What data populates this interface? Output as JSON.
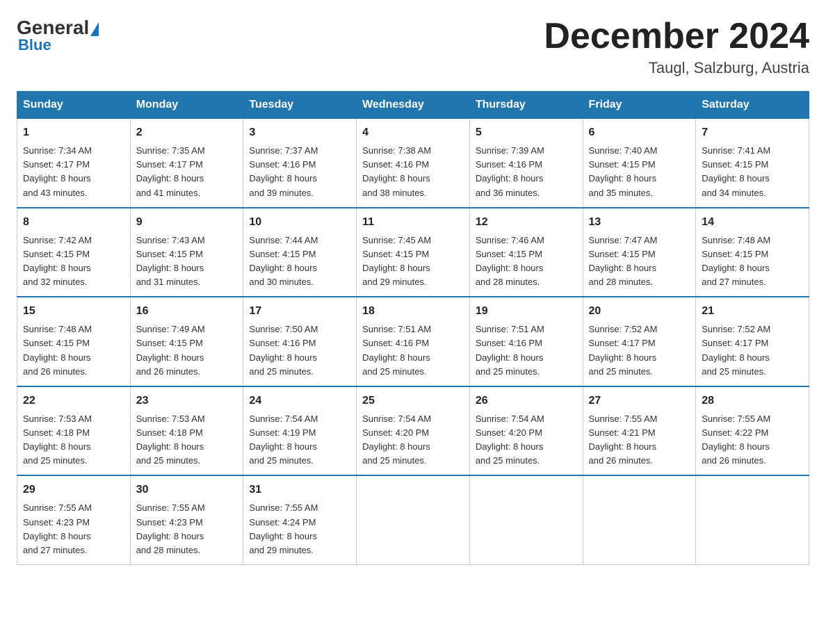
{
  "logo": {
    "general": "General",
    "blue": "Blue",
    "subtitle": "Blue"
  },
  "header": {
    "title": "December 2024",
    "location": "Taugl, Salzburg, Austria"
  },
  "weekdays": [
    "Sunday",
    "Monday",
    "Tuesday",
    "Wednesday",
    "Thursday",
    "Friday",
    "Saturday"
  ],
  "weeks": [
    [
      {
        "day": "1",
        "sunrise": "7:34 AM",
        "sunset": "4:17 PM",
        "daylight": "8 hours and 43 minutes."
      },
      {
        "day": "2",
        "sunrise": "7:35 AM",
        "sunset": "4:17 PM",
        "daylight": "8 hours and 41 minutes."
      },
      {
        "day": "3",
        "sunrise": "7:37 AM",
        "sunset": "4:16 PM",
        "daylight": "8 hours and 39 minutes."
      },
      {
        "day": "4",
        "sunrise": "7:38 AM",
        "sunset": "4:16 PM",
        "daylight": "8 hours and 38 minutes."
      },
      {
        "day": "5",
        "sunrise": "7:39 AM",
        "sunset": "4:16 PM",
        "daylight": "8 hours and 36 minutes."
      },
      {
        "day": "6",
        "sunrise": "7:40 AM",
        "sunset": "4:15 PM",
        "daylight": "8 hours and 35 minutes."
      },
      {
        "day": "7",
        "sunrise": "7:41 AM",
        "sunset": "4:15 PM",
        "daylight": "8 hours and 34 minutes."
      }
    ],
    [
      {
        "day": "8",
        "sunrise": "7:42 AM",
        "sunset": "4:15 PM",
        "daylight": "8 hours and 32 minutes."
      },
      {
        "day": "9",
        "sunrise": "7:43 AM",
        "sunset": "4:15 PM",
        "daylight": "8 hours and 31 minutes."
      },
      {
        "day": "10",
        "sunrise": "7:44 AM",
        "sunset": "4:15 PM",
        "daylight": "8 hours and 30 minutes."
      },
      {
        "day": "11",
        "sunrise": "7:45 AM",
        "sunset": "4:15 PM",
        "daylight": "8 hours and 29 minutes."
      },
      {
        "day": "12",
        "sunrise": "7:46 AM",
        "sunset": "4:15 PM",
        "daylight": "8 hours and 28 minutes."
      },
      {
        "day": "13",
        "sunrise": "7:47 AM",
        "sunset": "4:15 PM",
        "daylight": "8 hours and 28 minutes."
      },
      {
        "day": "14",
        "sunrise": "7:48 AM",
        "sunset": "4:15 PM",
        "daylight": "8 hours and 27 minutes."
      }
    ],
    [
      {
        "day": "15",
        "sunrise": "7:48 AM",
        "sunset": "4:15 PM",
        "daylight": "8 hours and 26 minutes."
      },
      {
        "day": "16",
        "sunrise": "7:49 AM",
        "sunset": "4:15 PM",
        "daylight": "8 hours and 26 minutes."
      },
      {
        "day": "17",
        "sunrise": "7:50 AM",
        "sunset": "4:16 PM",
        "daylight": "8 hours and 25 minutes."
      },
      {
        "day": "18",
        "sunrise": "7:51 AM",
        "sunset": "4:16 PM",
        "daylight": "8 hours and 25 minutes."
      },
      {
        "day": "19",
        "sunrise": "7:51 AM",
        "sunset": "4:16 PM",
        "daylight": "8 hours and 25 minutes."
      },
      {
        "day": "20",
        "sunrise": "7:52 AM",
        "sunset": "4:17 PM",
        "daylight": "8 hours and 25 minutes."
      },
      {
        "day": "21",
        "sunrise": "7:52 AM",
        "sunset": "4:17 PM",
        "daylight": "8 hours and 25 minutes."
      }
    ],
    [
      {
        "day": "22",
        "sunrise": "7:53 AM",
        "sunset": "4:18 PM",
        "daylight": "8 hours and 25 minutes."
      },
      {
        "day": "23",
        "sunrise": "7:53 AM",
        "sunset": "4:18 PM",
        "daylight": "8 hours and 25 minutes."
      },
      {
        "day": "24",
        "sunrise": "7:54 AM",
        "sunset": "4:19 PM",
        "daylight": "8 hours and 25 minutes."
      },
      {
        "day": "25",
        "sunrise": "7:54 AM",
        "sunset": "4:20 PM",
        "daylight": "8 hours and 25 minutes."
      },
      {
        "day": "26",
        "sunrise": "7:54 AM",
        "sunset": "4:20 PM",
        "daylight": "8 hours and 25 minutes."
      },
      {
        "day": "27",
        "sunrise": "7:55 AM",
        "sunset": "4:21 PM",
        "daylight": "8 hours and 26 minutes."
      },
      {
        "day": "28",
        "sunrise": "7:55 AM",
        "sunset": "4:22 PM",
        "daylight": "8 hours and 26 minutes."
      }
    ],
    [
      {
        "day": "29",
        "sunrise": "7:55 AM",
        "sunset": "4:23 PM",
        "daylight": "8 hours and 27 minutes."
      },
      {
        "day": "30",
        "sunrise": "7:55 AM",
        "sunset": "4:23 PM",
        "daylight": "8 hours and 28 minutes."
      },
      {
        "day": "31",
        "sunrise": "7:55 AM",
        "sunset": "4:24 PM",
        "daylight": "8 hours and 29 minutes."
      },
      null,
      null,
      null,
      null
    ]
  ],
  "labels": {
    "sunrise": "Sunrise: ",
    "sunset": "Sunset: ",
    "daylight": "Daylight: "
  }
}
